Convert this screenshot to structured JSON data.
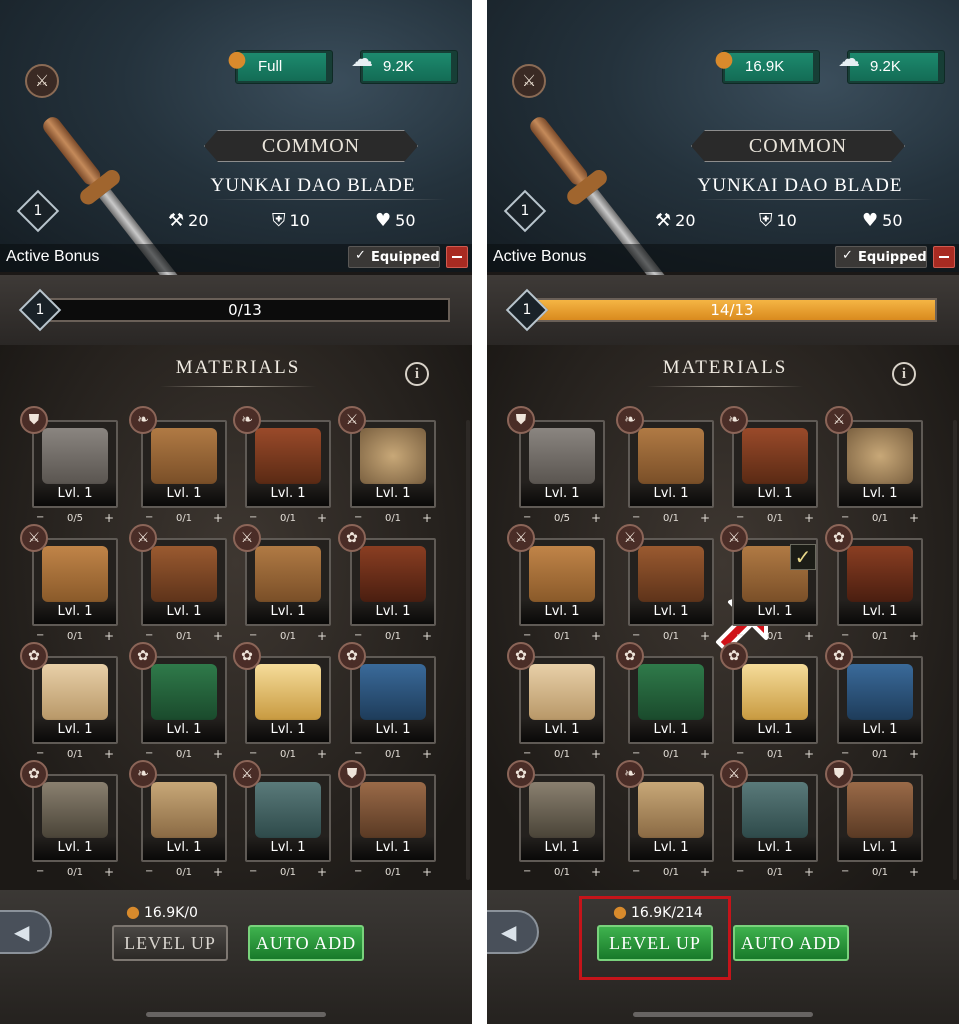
{
  "left": {
    "resources": {
      "bread": "Full",
      "food": "9.2K"
    },
    "item": {
      "rarity": "COMMON",
      "name": "YUNKAI DAO BLADE",
      "level": "1",
      "attack": "20",
      "defense": "10",
      "health": "50"
    },
    "active_bonus": "Active Bonus",
    "equipped_label": "Equipped",
    "progress": {
      "level": "1",
      "text": "0/13",
      "fraction": 0
    },
    "materials_title": "MATERIALS",
    "materials": [
      {
        "lvl": "Lvl. 1",
        "count": "0/5",
        "cat": "shield-icon",
        "art": "armor"
      },
      {
        "lvl": "Lvl. 1",
        "count": "0/1",
        "cat": "leaf-icon",
        "art": "shield-wood"
      },
      {
        "lvl": "Lvl. 1",
        "count": "0/1",
        "cat": "leaf-icon",
        "art": "chest"
      },
      {
        "lvl": "Lvl. 1",
        "count": "0/1",
        "cat": "sword-icon",
        "art": "round-shield"
      },
      {
        "lvl": "Lvl. 1",
        "count": "0/1",
        "cat": "sword-icon",
        "art": "helm-shield"
      },
      {
        "lvl": "Lvl. 1",
        "count": "0/1",
        "cat": "sword-icon",
        "art": "gauntlet"
      },
      {
        "lvl": "Lvl. 1",
        "count": "0/1",
        "cat": "sword-icon",
        "art": "tower-shield"
      },
      {
        "lvl": "Lvl. 1",
        "count": "0/1",
        "cat": "flower-icon",
        "art": "hood"
      },
      {
        "lvl": "Lvl. 1",
        "count": "0/1",
        "cat": "flower-icon",
        "art": "scroll"
      },
      {
        "lvl": "Lvl. 1",
        "count": "0/1",
        "cat": "flower-icon",
        "art": "green-dress"
      },
      {
        "lvl": "Lvl. 1",
        "count": "0/1",
        "cat": "flower-icon",
        "art": "candle"
      },
      {
        "lvl": "Lvl. 1",
        "count": "0/1",
        "cat": "flower-icon",
        "art": "blue-dress"
      },
      {
        "lvl": "Lvl. 1",
        "count": "0/1",
        "cat": "flower-icon",
        "art": "sword-stand"
      },
      {
        "lvl": "Lvl. 1",
        "count": "0/1",
        "cat": "leaf-icon",
        "art": "vest"
      },
      {
        "lvl": "Lvl. 1",
        "count": "0/1",
        "cat": "sword-icon",
        "art": "bracer"
      },
      {
        "lvl": "Lvl. 1",
        "count": "0/1",
        "cat": "shield-icon",
        "art": "helmet"
      }
    ],
    "cost": "16.9K/0",
    "level_up": "LEVEL UP",
    "auto_add": "AUTO ADD"
  },
  "right": {
    "resources": {
      "bread": "16.9K",
      "food": "9.2K"
    },
    "item": {
      "rarity": "COMMON",
      "name": "YUNKAI DAO BLADE",
      "level": "1",
      "attack": "20",
      "defense": "10",
      "health": "50"
    },
    "active_bonus": "Active Bonus",
    "equipped_label": "Equipped",
    "progress": {
      "level": "1",
      "text": "14/13",
      "fraction": 1
    },
    "materials_title": "MATERIALS",
    "materials": [
      {
        "lvl": "Lvl. 1",
        "count": "0/5",
        "cat": "shield-icon",
        "art": "armor"
      },
      {
        "lvl": "Lvl. 1",
        "count": "0/1",
        "cat": "leaf-icon",
        "art": "shield-wood"
      },
      {
        "lvl": "Lvl. 1",
        "count": "0/1",
        "cat": "leaf-icon",
        "art": "chest"
      },
      {
        "lvl": "Lvl. 1",
        "count": "0/1",
        "cat": "sword-icon",
        "art": "round-shield"
      },
      {
        "lvl": "Lvl. 1",
        "count": "0/1",
        "cat": "sword-icon",
        "art": "helm-shield"
      },
      {
        "lvl": "Lvl. 1",
        "count": "0/1",
        "cat": "sword-icon",
        "art": "gauntlet"
      },
      {
        "lvl": "Lvl. 1",
        "count": "0/1",
        "cat": "sword-icon",
        "art": "tower-shield",
        "checked": true
      },
      {
        "lvl": "Lvl. 1",
        "count": "0/1",
        "cat": "flower-icon",
        "art": "hood"
      },
      {
        "lvl": "Lvl. 1",
        "count": "0/1",
        "cat": "flower-icon",
        "art": "scroll"
      },
      {
        "lvl": "Lvl. 1",
        "count": "0/1",
        "cat": "flower-icon",
        "art": "green-dress"
      },
      {
        "lvl": "Lvl. 1",
        "count": "0/1",
        "cat": "flower-icon",
        "art": "candle"
      },
      {
        "lvl": "Lvl. 1",
        "count": "0/1",
        "cat": "flower-icon",
        "art": "blue-dress"
      },
      {
        "lvl": "Lvl. 1",
        "count": "0/1",
        "cat": "flower-icon",
        "art": "sword-stand"
      },
      {
        "lvl": "Lvl. 1",
        "count": "0/1",
        "cat": "leaf-icon",
        "art": "vest"
      },
      {
        "lvl": "Lvl. 1",
        "count": "0/1",
        "cat": "sword-icon",
        "art": "bracer"
      },
      {
        "lvl": "Lvl. 1",
        "count": "0/1",
        "cat": "shield-icon",
        "art": "helmet"
      }
    ],
    "cost": "16.9K/214",
    "level_up": "LEVEL UP",
    "auto_add": "AUTO ADD"
  },
  "colors": {
    "progress_fill": "#f0a838",
    "level_up_active": "#2f9a3f",
    "auto_add": "#2f9a3f",
    "highlight": "#c5141a",
    "arrow": "#d01218"
  }
}
